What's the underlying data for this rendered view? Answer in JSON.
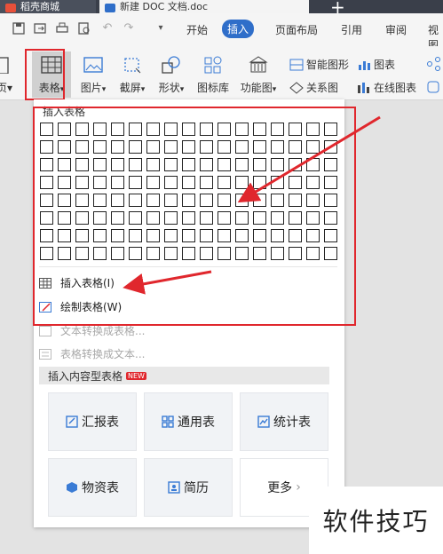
{
  "tabs": [
    {
      "label": "稻壳商城"
    },
    {
      "label": "新建 DOC 文档.doc"
    }
  ],
  "menu": [
    "开始",
    "插入",
    "页面布局",
    "引用",
    "审阅",
    "视图"
  ],
  "ribbon": {
    "page_label": "页",
    "table_label": "表格",
    "picture_label": "图片",
    "screenshot_label": "截屏",
    "shape_label": "形状",
    "iconlib_label": "图标库",
    "funcchart_label": "功能图",
    "smartart_label": "智能图形",
    "chart_label": "图表",
    "relation_label": "关系图",
    "onlinechart_label": "在线图表"
  },
  "dropdown": {
    "section_title": "插入表格",
    "grid_rows": 8,
    "grid_cols": 17,
    "insert_table": "插入表格(I)",
    "draw_table": "绘制表格(W)",
    "text_to_table": "文本转换成表格...",
    "table_to_text": "表格转换成文本...",
    "content_section": "插入内容型表格",
    "new_badge": "NEW",
    "cards": [
      {
        "label": "汇报表",
        "icon": "report-icon"
      },
      {
        "label": "通用表",
        "icon": "grid-icon"
      },
      {
        "label": "统计表",
        "icon": "chart-icon"
      },
      {
        "label": "物资表",
        "icon": "box-icon"
      },
      {
        "label": "简历",
        "icon": "resume-icon"
      },
      {
        "label": "更多",
        "icon": "chevron-right-icon"
      }
    ]
  },
  "watermark": "软件技巧",
  "colors": {
    "accent": "#2f6ec9",
    "annotation": "#e0272d"
  }
}
